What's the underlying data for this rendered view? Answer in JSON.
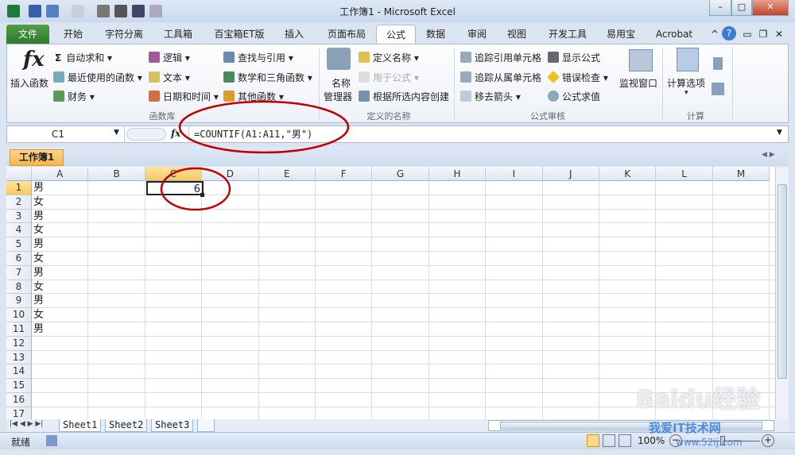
{
  "title": "工作簿1 - Microsoft Excel",
  "tabs": [
    "文件",
    "开始",
    "字符分离",
    "工具箱",
    "百宝箱ET版",
    "插入",
    "页面布局",
    "公式",
    "数据",
    "审阅",
    "视图",
    "开发工具",
    "易用宝",
    "Acrobat"
  ],
  "ribbon": {
    "insert_function": "插入函数",
    "fx": "fx",
    "lib": [
      "自动求和",
      "最近使用的函数",
      "财务",
      "逻辑",
      "文本",
      "日期和时间",
      "查找与引用",
      "数学和三角函数",
      "其他函数"
    ],
    "lib_group": "函数库",
    "name_manager": [
      "名称",
      "管理器"
    ],
    "names": [
      "定义名称",
      "用于公式",
      "根据所选内容创建"
    ],
    "names_group": "定义的名称",
    "audit": [
      "追踪引用单元格",
      "追踪从属单元格",
      "移去箭头",
      "显示公式",
      "错误检查",
      "公式求值"
    ],
    "watch": "监视窗口",
    "audit_group": "公式审核",
    "calc_options": "计算选项",
    "calc_group": "计算"
  },
  "formula_bar": {
    "name_box": "C1",
    "fx": "fx",
    "formula": "=COUNTIF(A1:A11,\"男\")"
  },
  "workbook_tab": "工作簿1",
  "columns": [
    "A",
    "B",
    "C",
    "D",
    "E",
    "F",
    "G",
    "H",
    "I",
    "J",
    "K",
    "L",
    "M"
  ],
  "rows": [
    "1",
    "2",
    "3",
    "4",
    "5",
    "6",
    "7",
    "8",
    "9",
    "10",
    "11",
    "12",
    "13",
    "14",
    "15",
    "16",
    "17"
  ],
  "column_a": [
    "男",
    "女",
    "男",
    "女",
    "男",
    "女",
    "男",
    "女",
    "男",
    "女",
    "男"
  ],
  "c1_value": "6",
  "sheets": [
    "Sheet1",
    "Sheet2",
    "Sheet3"
  ],
  "status": {
    "ready": "就绪",
    "zoom": "100%"
  },
  "watermark": {
    "text1": "Baidu经验",
    "text2": "我爱IT技术网",
    "text3": "www.52ij.com"
  },
  "colors": {
    "file_tab": "#2d7a2b",
    "annotation": "#c00000",
    "selected_header": "#f9c95d"
  }
}
